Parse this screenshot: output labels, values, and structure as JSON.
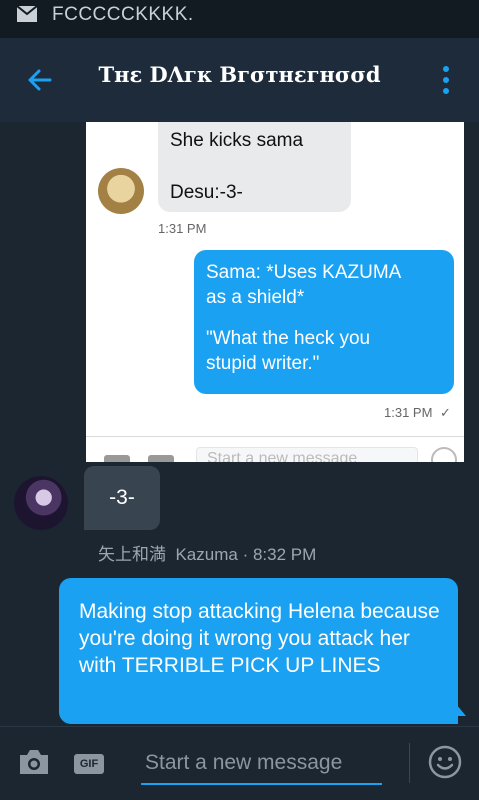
{
  "status_bar": {
    "text": "FCCCCCKKKK.",
    "icon": "mail-icon"
  },
  "app_bar": {
    "title": "Tнε DΛгк Bгσтнεгнσσd",
    "back_icon": "arrow-left-icon",
    "menu_icon": "more-vertical-icon",
    "background": "#1d2b3a",
    "accent": "#1ba1f2"
  },
  "screenshot_attachment": {
    "received": {
      "line1": "She kicks sama",
      "line2": "Desu:-3-",
      "time": "1:31 PM"
    },
    "sent": {
      "line1": "Sama: *Uses KAZUMA",
      "line2": "as a shield*",
      "line3": "\"What the heck you",
      "line4": "stupid writer.\"",
      "time": "1:31 PM",
      "status": "✓"
    },
    "composer_placeholder": "Start a new message"
  },
  "messages": {
    "received": {
      "text": "-3-",
      "author_jp": "矢上和満",
      "author": "Kazuma",
      "time": "8:32 PM"
    },
    "sent": {
      "text": "Making stop attacking Helena because you're doing it wrong you attack her with TERRIBLE PICK UP LINES"
    }
  },
  "composer": {
    "placeholder": "Start a new message",
    "gif_label": "GIF",
    "camera_icon": "camera-icon",
    "emoji_icon": "emoji-icon"
  }
}
